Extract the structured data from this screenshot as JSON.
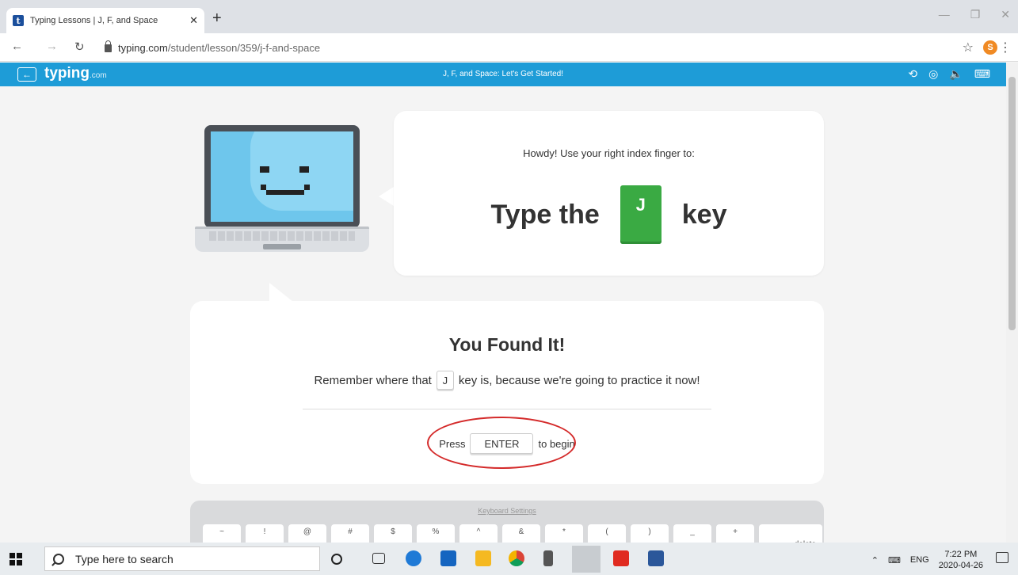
{
  "browser": {
    "tab_title": "Typing Lessons | J, F, and Space",
    "tab_close": "✕",
    "new_tab": "+",
    "favicon_letter": "t",
    "url_domain": "typing.com",
    "url_path": "/student/lesson/359/j-f-and-space",
    "profile_initial": "S"
  },
  "site_header": {
    "logo": "typing",
    "logo_suffix": ".com",
    "title": "J, F, and Space: Let's Get Started!",
    "color": "#1e9cd7"
  },
  "bubble": {
    "prompt": "Howdy! Use your right index finger to:",
    "type_prefix": "Type the",
    "key": "J",
    "type_suffix": "key"
  },
  "found": {
    "title": "You Found It!",
    "remember_prefix": "Remember where that",
    "key": "J",
    "remember_suffix": "key is, because we're going to practice it now!",
    "press_prefix": "Press",
    "enter_key": "ENTER",
    "press_suffix": "to begin"
  },
  "keyboard": {
    "settings_link": "Keyboard Settings",
    "keys": [
      "~",
      "!",
      "@",
      "#",
      "$",
      "%",
      "^",
      "&",
      "*",
      "(",
      ")",
      "_",
      "+"
    ],
    "delete_label": "delete"
  },
  "taskbar": {
    "search_placeholder": "Type here to search",
    "language": "ENG",
    "time": "7:22 PM",
    "date": "2020-04-26"
  },
  "colors": {
    "accent": "#1e9cd7",
    "key_green": "#3aaa43",
    "annotation_red": "#d42a2a"
  }
}
